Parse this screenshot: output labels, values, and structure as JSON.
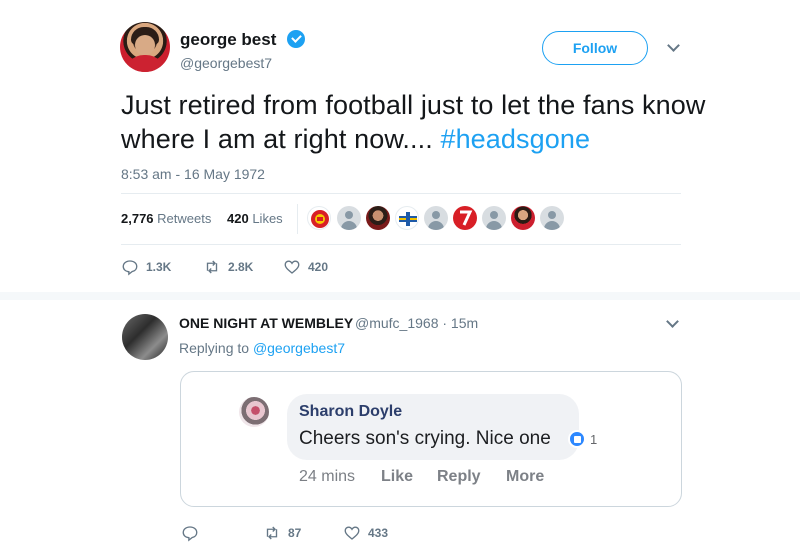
{
  "author": {
    "name": "george best",
    "handle": "@georgebest7",
    "follow_label": "Follow"
  },
  "tweet": {
    "text_before": "Just retired from football just to let the fans know where I am at right now.... ",
    "hashtag": "#headsgone",
    "timestamp": "8:53 am - 16 May 1972"
  },
  "stats": {
    "retweets_count": "2,776",
    "retweets_label": "Retweets",
    "likes_count": "420",
    "likes_label": "Likes"
  },
  "actions": {
    "reply_count": "1.3K",
    "retweet_count": "2.8K",
    "like_count": "420"
  },
  "reply": {
    "name": "ONE NIGHT AT WEMBLEY",
    "handle_time": "@mufc_1968 · 15m",
    "replying_prefix": "Replying to ",
    "replying_to": "@georgebest7",
    "actions": {
      "reply_count": "",
      "retweet_count": "87",
      "like_count": "433"
    }
  },
  "embedded_comment": {
    "name": "Sharon Doyle",
    "text": "Cheers son's crying. Nice one",
    "like_count": "1",
    "time": "24 mins",
    "like_label": "Like",
    "reply_label": "Reply",
    "more_label": "More"
  },
  "colors": {
    "accent": "#1da1f2",
    "muted": "#657786",
    "verified": "#1da1f2",
    "facebook_blue": "#2d88ff"
  },
  "icons": [
    "verified-badge-icon",
    "chevron-down-icon",
    "reply-icon",
    "retweet-icon",
    "like-icon",
    "thumbs-up-icon"
  ]
}
